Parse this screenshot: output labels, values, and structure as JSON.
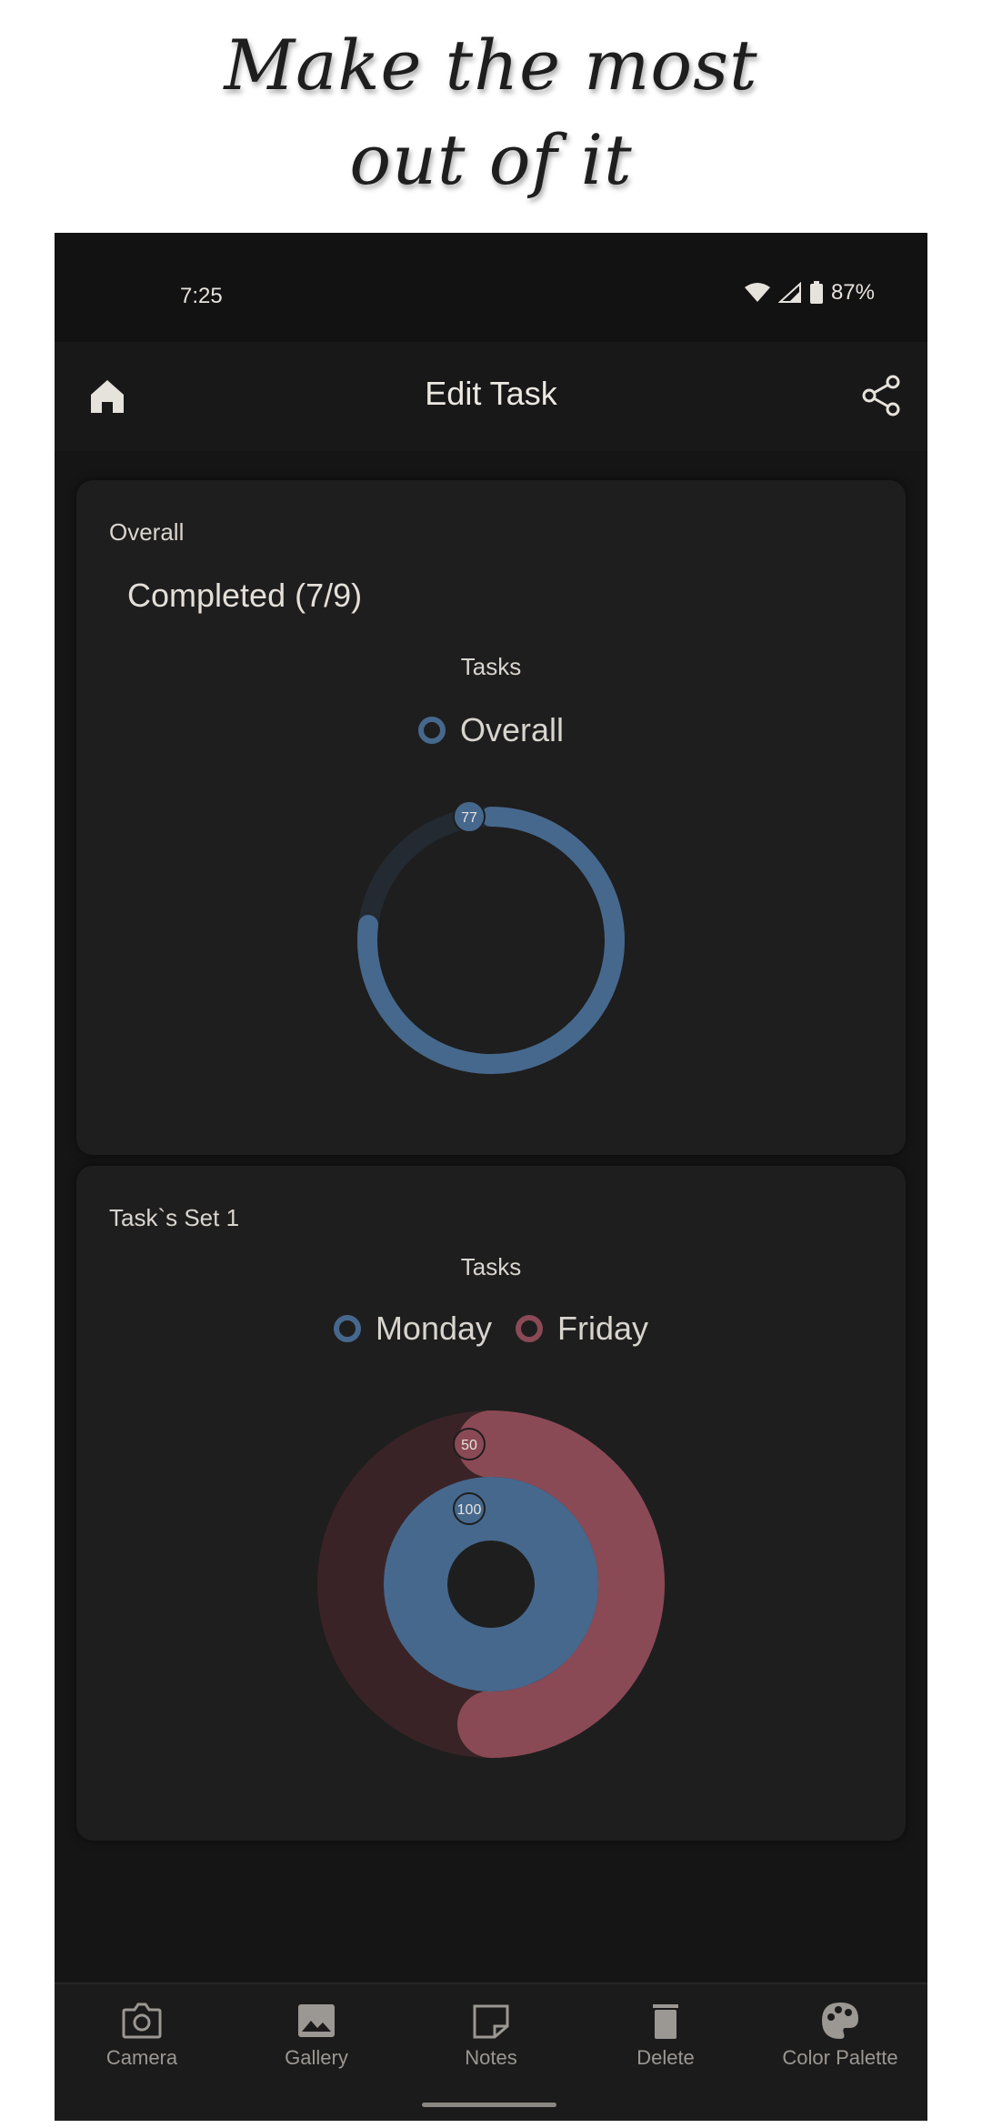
{
  "promo": {
    "line1": "Make the most",
    "line2": "out of it"
  },
  "status": {
    "time": "7:25",
    "battery": "87%"
  },
  "appbar": {
    "title": "Edit Task"
  },
  "card_overall": {
    "label": "Overall",
    "completed": "Completed (7/9)",
    "chart_title": "Tasks",
    "legend": "Overall"
  },
  "card_set1": {
    "label": "Task`s Set 1",
    "chart_title": "Tasks",
    "legend": [
      "Monday",
      "Friday"
    ]
  },
  "chart_data": [
    {
      "type": "donut",
      "title": "Tasks",
      "series": [
        {
          "name": "Overall",
          "value": 77,
          "color": "#46688d"
        }
      ],
      "max": 100
    },
    {
      "type": "donut",
      "title": "Tasks",
      "series": [
        {
          "name": "Monday",
          "value": 100,
          "color": "#46688d"
        },
        {
          "name": "Friday",
          "value": 50,
          "color": "#8a4a55"
        }
      ],
      "max": 100
    }
  ],
  "nav": {
    "camera": "Camera",
    "gallery": "Gallery",
    "notes": "Notes",
    "delete": "Delete",
    "palette": "Color Palette"
  },
  "colors": {
    "blue": "#46688d",
    "red": "#8a4a55",
    "background": "#151515",
    "card": "#1e1e1e"
  }
}
